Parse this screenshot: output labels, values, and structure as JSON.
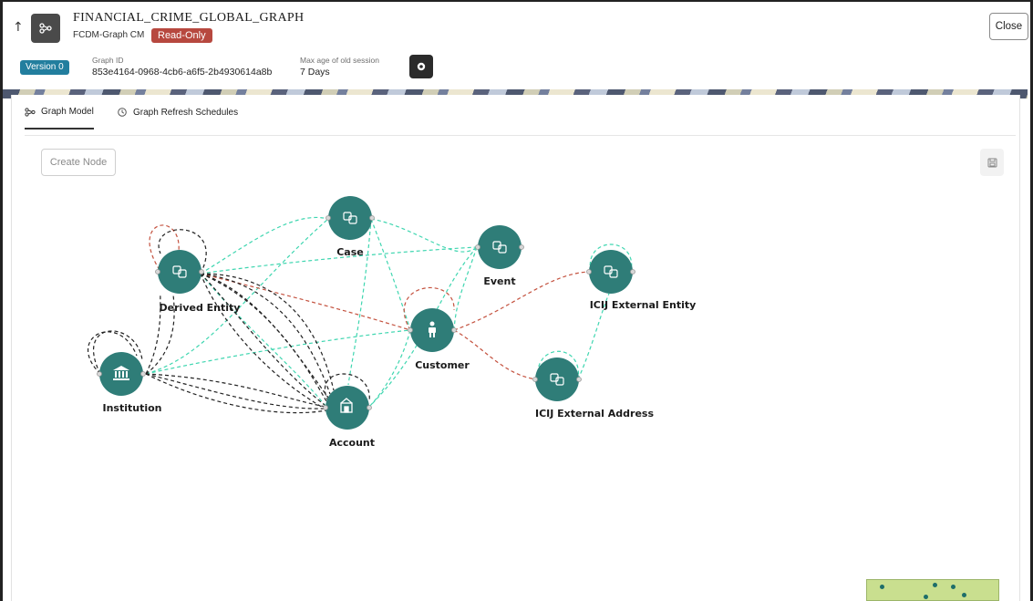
{
  "header": {
    "title": "FINANCIAL_CRIME_GLOBAL_GRAPH",
    "subtitle": "FCDM-Graph CM",
    "status_badge": "Read-Only",
    "close_label": "Close",
    "version_badge": "Version 0",
    "graph_id_label": "Graph ID",
    "graph_id_value": "853e4164-0968-4cb6-a6f5-2b4930614a8b",
    "max_age_label": "Max age of old session",
    "max_age_value": "7 Days"
  },
  "tabs": [
    {
      "label": "Graph Model",
      "icon": "graph-icon",
      "active": true
    },
    {
      "label": "Graph Refresh Schedules",
      "icon": "schedule-icon",
      "active": false
    }
  ],
  "toolbar": {
    "create_node_label": "Create Node",
    "save_icon": "save-icon"
  },
  "graph": {
    "node_color": "#2f7d78",
    "edge_colors": {
      "teal": "#3fd6b0",
      "red": "#c4523f",
      "black": "#222222"
    },
    "nodes": [
      {
        "id": "case",
        "label": "Case",
        "icon": "entity-icon"
      },
      {
        "id": "event",
        "label": "Event",
        "icon": "entity-icon"
      },
      {
        "id": "derived",
        "label": "Derived Entity",
        "icon": "entity-icon"
      },
      {
        "id": "icij_entity",
        "label": "ICIJ External Entity",
        "icon": "entity-icon"
      },
      {
        "id": "customer",
        "label": "Customer",
        "icon": "person-icon"
      },
      {
        "id": "institution",
        "label": "Institution",
        "icon": "bank-icon"
      },
      {
        "id": "icij_address",
        "label": "ICIJ External Address",
        "icon": "entity-icon"
      },
      {
        "id": "account",
        "label": "Account",
        "icon": "account-icon"
      }
    ]
  }
}
